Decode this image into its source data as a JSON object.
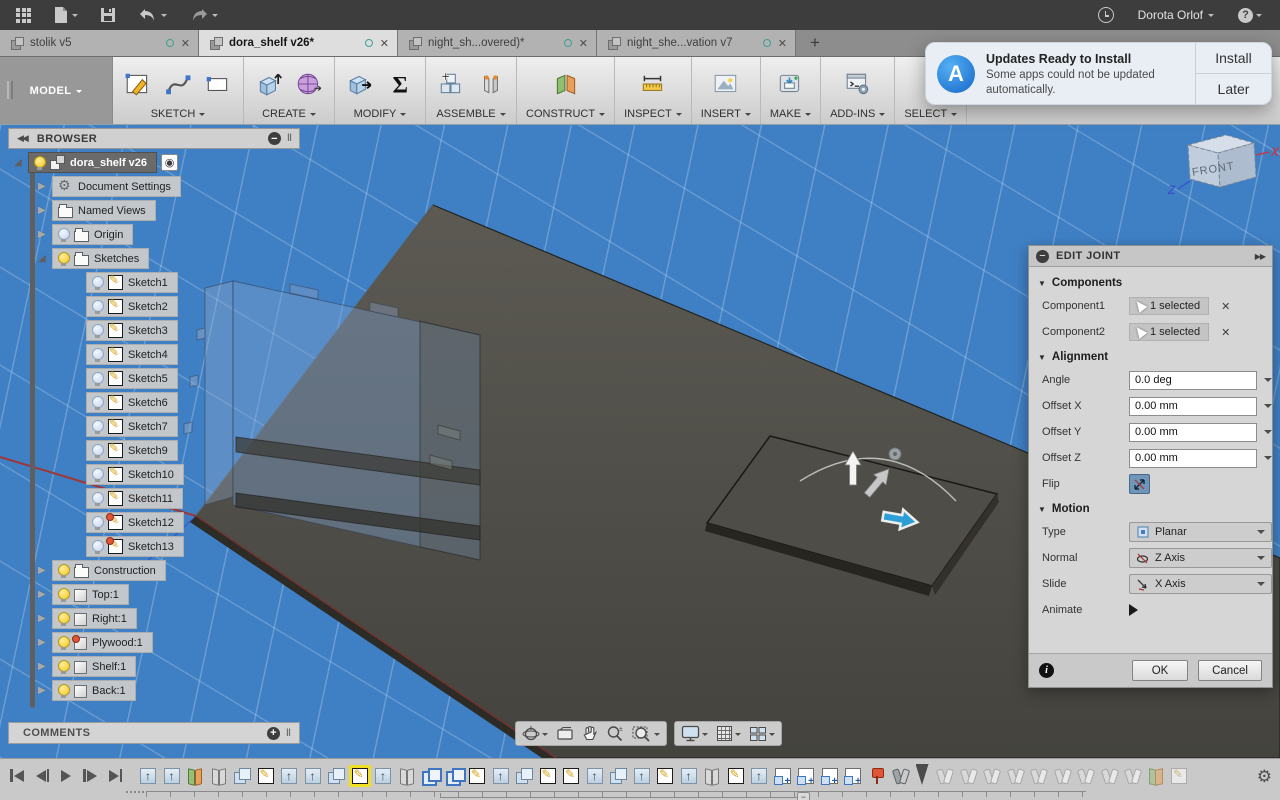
{
  "titlebar": {
    "user": "Dorota Orlof",
    "icons": [
      "apps-grid-icon",
      "file-icon",
      "save-icon",
      "undo-icon",
      "redo-icon",
      "clock-icon",
      "help-icon"
    ]
  },
  "tabs": {
    "items": [
      {
        "label": "stolik v5",
        "cls": ""
      },
      {
        "label": "dora_shelf v26*",
        "cls": "active"
      },
      {
        "label": "night_sh...overed)*",
        "cls": ""
      },
      {
        "label": "night_she...vation v7",
        "cls": ""
      }
    ]
  },
  "toolbar": {
    "workspace": "MODEL",
    "groups": [
      {
        "label": "SKETCH"
      },
      {
        "label": "CREATE"
      },
      {
        "label": "MODIFY"
      },
      {
        "label": "ASSEMBLE"
      },
      {
        "label": "CONSTRUCT"
      },
      {
        "label": "INSPECT"
      },
      {
        "label": "INSERT"
      },
      {
        "label": "MAKE"
      },
      {
        "label": "ADD-INS"
      },
      {
        "label": "SELECT"
      }
    ]
  },
  "notification": {
    "title": "Updates Ready to Install",
    "body": "Some apps could not be updated automatically.",
    "install": "Install",
    "later": "Later"
  },
  "browser": {
    "header": "BROWSER",
    "items": [
      {
        "label": "dora_shelf v26",
        "cls": "lvl0 arr-exp bulb-on ic-component selected target-on"
      },
      {
        "label": "Document Settings",
        "cls": "lvl1 arr-col ic-gear"
      },
      {
        "label": "Named Views",
        "cls": "lvl1 arr-col ic-folder"
      },
      {
        "label": "Origin",
        "cls": "lvl1 arr-col bulb-off ic-folder"
      },
      {
        "label": "Sketches",
        "cls": "lvl1 arr-exp bulb-on ic-folder"
      },
      {
        "label": "Sketch1",
        "cls": "lvl2 bulb-off ic-sketch"
      },
      {
        "label": "Sketch2",
        "cls": "lvl2 bulb-off ic-sketch"
      },
      {
        "label": "Sketch3",
        "cls": "lvl2 bulb-off ic-sketch"
      },
      {
        "label": "Sketch4",
        "cls": "lvl2 bulb-off ic-sketch"
      },
      {
        "label": "Sketch5",
        "cls": "lvl2 bulb-off ic-sketch"
      },
      {
        "label": "Sketch6",
        "cls": "lvl2 bulb-off ic-sketch"
      },
      {
        "label": "Sketch7",
        "cls": "lvl2 bulb-off ic-sketch"
      },
      {
        "label": "Sketch9",
        "cls": "lvl2 bulb-off ic-sketch"
      },
      {
        "label": "Sketch10",
        "cls": "lvl2 bulb-off ic-sketch"
      },
      {
        "label": "Sketch11",
        "cls": "lvl2 bulb-off ic-sketch"
      },
      {
        "label": "Sketch12",
        "cls": "lvl2 bulb-off ic-sketch pin"
      },
      {
        "label": "Sketch13",
        "cls": "lvl2 bulb-off ic-sketch pin"
      },
      {
        "label": "Construction",
        "cls": "lvl1 arr-col bulb-on ic-folder"
      },
      {
        "label": "Top:1",
        "cls": "lvl1 arr-col bulb-on ic-body"
      },
      {
        "label": "Right:1",
        "cls": "lvl1 arr-col bulb-on ic-body"
      },
      {
        "label": "Plywood:1",
        "cls": "lvl1 arr-col bulb-on ic-body pin"
      },
      {
        "label": "Shelf:1",
        "cls": "lvl1 arr-col bulb-on ic-body"
      },
      {
        "label": "Back:1",
        "cls": "lvl1 arr-col bulb-on ic-body"
      }
    ]
  },
  "viewcube": {
    "front": "FRONT",
    "x_axis": "X",
    "z_axis": "Z"
  },
  "edit_joint": {
    "title": "EDIT JOINT",
    "section_components": "Components",
    "section_alignment": "Alignment",
    "section_motion": "Motion",
    "component1_label": "Component1",
    "component1_value": "1 selected",
    "component2_label": "Component2",
    "component2_value": "1 selected",
    "angle_label": "Angle",
    "angle_value": "0.0 deg",
    "offset_x_label": "Offset X",
    "offset_x_value": "0.00 mm",
    "offset_y_label": "Offset Y",
    "offset_y_value": "0.00 mm",
    "offset_z_label": "Offset Z",
    "offset_z_value": "0.00 mm",
    "flip_label": "Flip",
    "type_label": "Type",
    "type_value": "Planar",
    "normal_label": "Normal",
    "normal_value": "Z Axis",
    "slide_label": "Slide",
    "slide_value": "X Axis",
    "animate_label": "Animate",
    "ok": "OK",
    "cancel": "Cancel"
  },
  "comments": {
    "label": "COMMENTS"
  },
  "navbar": {
    "icons": [
      "orbit-icon",
      "look-at-icon",
      "pan-icon",
      "zoom-icon",
      "window-zoom-icon",
      "display-settings-icon",
      "grid-settings-icon",
      "viewports-icon"
    ]
  },
  "timeline": {
    "items": [
      {
        "cls": "extrude"
      },
      {
        "cls": "extrude"
      },
      {
        "cls": "mirrorc"
      },
      {
        "cls": "mirror"
      },
      {
        "cls": "move"
      },
      {
        "cls": "sketch"
      },
      {
        "cls": "extrude"
      },
      {
        "cls": "extrude"
      },
      {
        "cls": "move"
      },
      {
        "cls": "sketch hl"
      },
      {
        "cls": "extrude"
      },
      {
        "cls": "mirror"
      },
      {
        "cls": "pattern"
      },
      {
        "cls": "pattern"
      },
      {
        "cls": "sketch"
      },
      {
        "cls": "extrude"
      },
      {
        "cls": "move"
      },
      {
        "cls": "sketch"
      },
      {
        "cls": "sketch"
      },
      {
        "cls": "extrude"
      },
      {
        "cls": "move"
      },
      {
        "cls": "extrude"
      },
      {
        "cls": "sketch"
      },
      {
        "cls": "extrude"
      },
      {
        "cls": "mirror"
      },
      {
        "cls": "sketch"
      },
      {
        "cls": "extrude"
      },
      {
        "cls": "component"
      },
      {
        "cls": "component"
      },
      {
        "cls": "component"
      },
      {
        "cls": "component"
      },
      {
        "cls": "pinic"
      },
      {
        "cls": "joint"
      },
      {
        "cls": "playhead"
      },
      {
        "cls": "jointg"
      },
      {
        "cls": "jointg"
      },
      {
        "cls": "jointg"
      },
      {
        "cls": "jointg"
      },
      {
        "cls": "jointg"
      },
      {
        "cls": "jointg"
      },
      {
        "cls": "jointg"
      },
      {
        "cls": "jointg"
      },
      {
        "cls": "jointg"
      },
      {
        "cls": "planeg"
      },
      {
        "cls": "sketchg"
      }
    ]
  },
  "colors": {
    "viewport_blue": "#3f80c5",
    "accent_blue_arrow": "#2e9fd6",
    "highlight_yellow": "#f0e024",
    "sync_teal": "#3aa392",
    "pin_red": "#e05536"
  }
}
